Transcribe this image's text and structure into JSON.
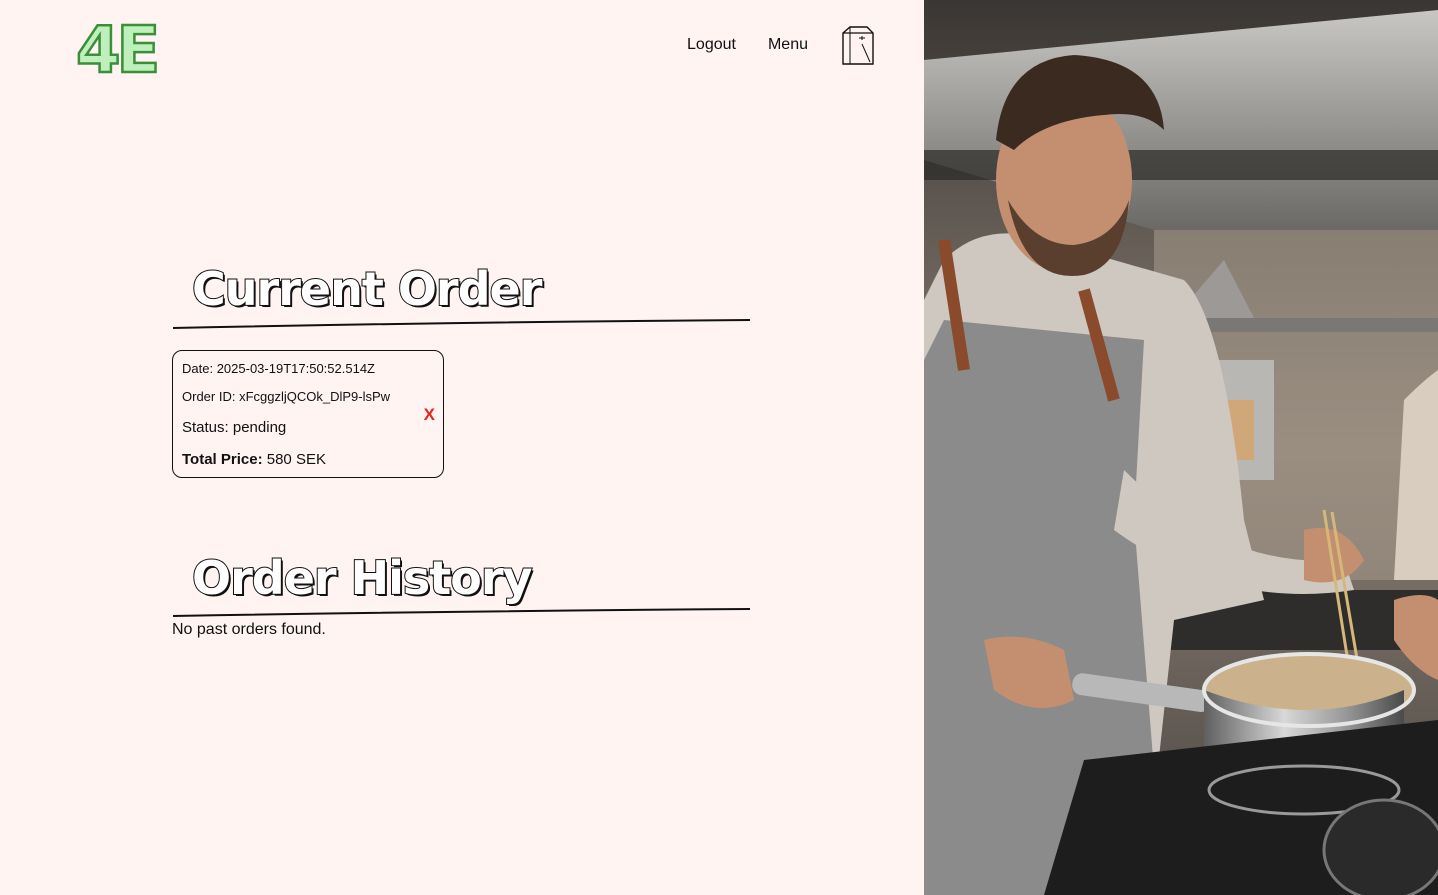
{
  "header": {
    "logo_text": "4E",
    "nav": {
      "logout_label": "Logout",
      "menu_label": "Menu"
    },
    "cart_icon": "shopping-bag-icon"
  },
  "current_order": {
    "heading": "Current Order",
    "date_label": "Date:",
    "date_value": "2025-03-19T17:50:52.514Z",
    "order_id_label": "Order ID:",
    "order_id_value": "xFcggzljQCOk_DlP9-lsPw",
    "status_label": "Status:",
    "status_value": "pending",
    "total_label": "Total Price:",
    "total_value": "580 SEK",
    "cancel_label": "X"
  },
  "order_history": {
    "heading": "Order History",
    "empty_text": "No past orders found."
  },
  "colors": {
    "background": "#fff4f2",
    "logo_green": "#7ddc7a",
    "cancel_red": "#e0281c"
  }
}
